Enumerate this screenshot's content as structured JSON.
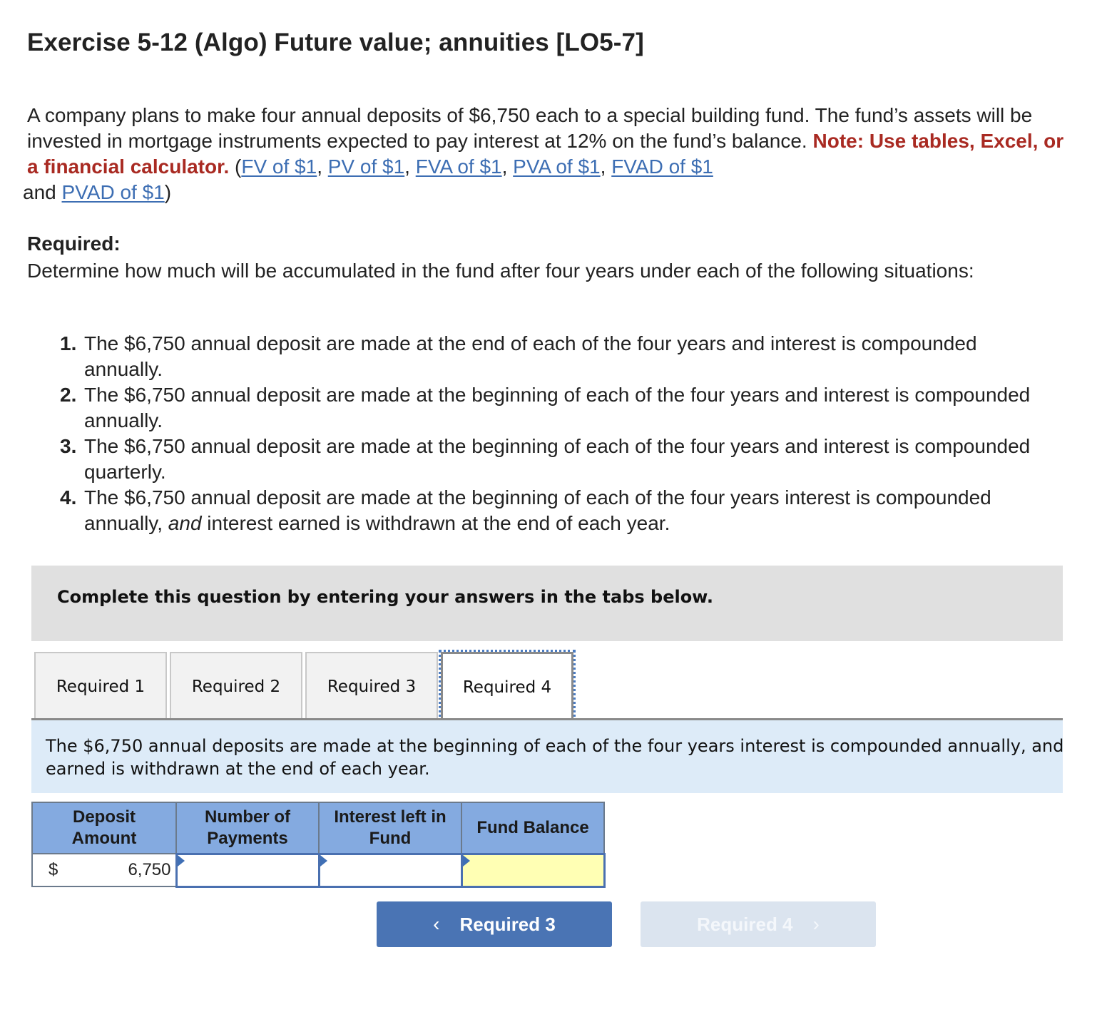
{
  "title": "Exercise 5-12 (Algo) Future value; annuities [LO5-7]",
  "intro": {
    "text": "A company plans to make four annual deposits of $6,750 each to a special building fund. The fund’s assets will be invested in mortgage instruments expected to pay interest at 12% on the fund’s balance.",
    "note": "Note: Use tables, Excel, or a financial calculator.",
    "open_paren": " (",
    "links": [
      "FV of $1",
      "PV of $1",
      "FVA of $1",
      "PVA of $1",
      "FVAD of $1",
      "PVAD of $1"
    ],
    "sep": ", ",
    "and": " and ",
    "close_paren": ")"
  },
  "required": {
    "heading": "Required:",
    "description": "Determine how much will be accumulated in the fund after four years under each of the following situations:",
    "items": [
      {
        "num": "1.",
        "text": "The $6,750 annual deposit are made at the end of each of the four years and interest is compounded annually."
      },
      {
        "num": "2.",
        "text": "The $6,750 annual deposit are made at the beginning of each of the four years and interest is compounded annually."
      },
      {
        "num": "3.",
        "text": "The $6,750 annual deposit are made at the beginning of each of the four years and interest is compounded quarterly."
      },
      {
        "num": "4.",
        "pre": "The $6,750 annual deposit are made at the beginning of each of the four years interest is compounded annually, ",
        "em": "and",
        "post": " interest earned is withdrawn at the end of each year."
      }
    ]
  },
  "instruction": "Complete this question by entering your answers in the tabs below.",
  "tabs": [
    {
      "label": "Required 1",
      "active": false
    },
    {
      "label": "Required 2",
      "active": false
    },
    {
      "label": "Required 3",
      "active": false
    },
    {
      "label": "Required 4",
      "active": true
    }
  ],
  "panel": {
    "text": "The $6,750 annual deposits are made at the beginning of each of the four years interest is compounded annually, and interest earned is withdrawn at the end of each year."
  },
  "table": {
    "headers": [
      "Deposit Amount",
      "Number of Payments",
      "Interest left in Fund",
      "Fund Balance"
    ],
    "row": {
      "currency": "$",
      "deposit": "6,750",
      "payments": "",
      "interest_left": "",
      "fund_balance": ""
    }
  },
  "nav": {
    "prev_label": "Required 3",
    "next_label": "Required 4",
    "prev_icon": "chevron-left-icon",
    "next_icon": "chevron-right-icon",
    "prev_glyph": "‹",
    "next_glyph": "›"
  },
  "colors": {
    "note_red": "#a92a22",
    "link_blue": "#3d6eb3",
    "header_blue": "#84aae0",
    "panel_blue": "#ddebf8",
    "answer_yellow": "#ffffb4",
    "button_blue": "#4a74b4",
    "button_disabled": "#dbe4ef"
  }
}
